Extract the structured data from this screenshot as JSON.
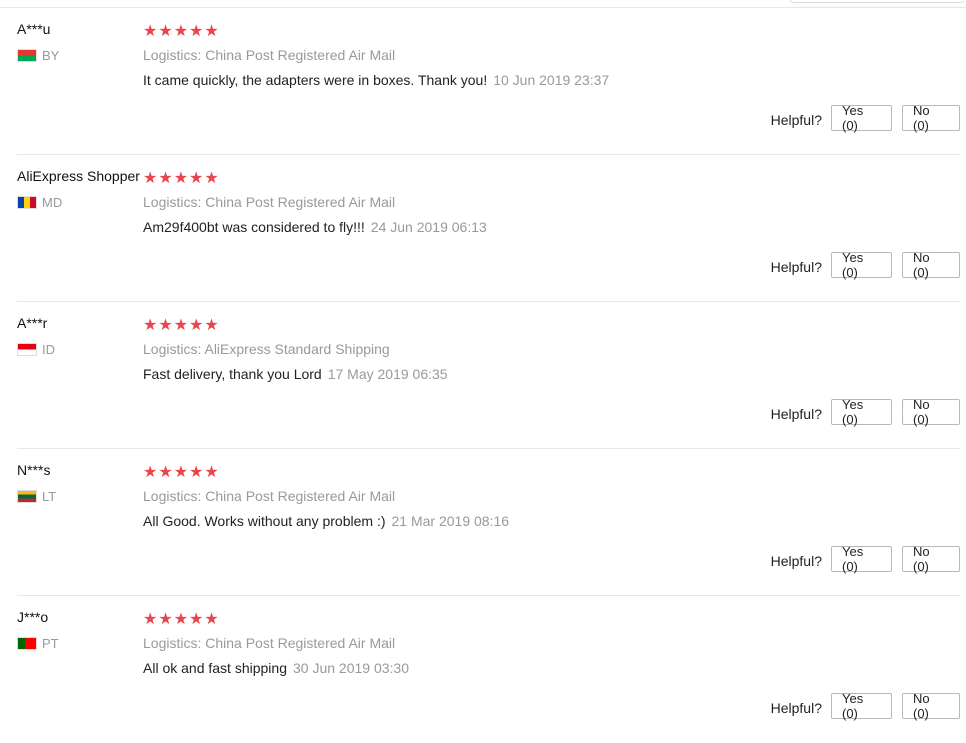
{
  "reviews": [
    {
      "user": "A***u",
      "country": "BY",
      "flag_colors": [
        "#e6372f",
        "#00a651"
      ],
      "stars": "★★★★★",
      "logistics_label": "Logistics:",
      "logistics": "China Post Registered Air Mail",
      "comment": "It came quickly, the adapters were in boxes. Thank you!",
      "date": "10 Jun 2019 23:37",
      "helpful_label": "Helpful?",
      "yes_label": "Yes (0)",
      "no_label": "No (0)"
    },
    {
      "user": "AliExpress Shopper",
      "country": "MD",
      "flag_colors": [
        "#0046ae",
        "#ffd200",
        "#cc092f"
      ],
      "stars": "★★★★★",
      "logistics_label": "Logistics:",
      "logistics": "China Post Registered Air Mail",
      "comment": "Am29f400bt was considered to fly!!!",
      "date": "24 Jun 2019 06:13",
      "helpful_label": "Helpful?",
      "yes_label": "Yes (0)",
      "no_label": "No (0)"
    },
    {
      "user": "A***r",
      "country": "ID",
      "flag_colors": [
        "#e70011",
        "#ffffff"
      ],
      "stars": "★★★★★",
      "logistics_label": "Logistics:",
      "logistics": "AliExpress Standard Shipping",
      "comment": "Fast delivery, thank you Lord",
      "date": "17 May 2019 06:35",
      "helpful_label": "Helpful?",
      "yes_label": "Yes (0)",
      "no_label": "No (0)"
    },
    {
      "user": "N***s",
      "country": "LT",
      "flag_colors": [
        "#fdb913",
        "#006a44",
        "#c1272d"
      ],
      "stars": "★★★★★",
      "logistics_label": "Logistics:",
      "logistics": "China Post Registered Air Mail",
      "comment": "All Good. Works without any problem :)",
      "date": "21 Mar 2019 08:16",
      "helpful_label": "Helpful?",
      "yes_label": "Yes (0)",
      "no_label": "No (0)"
    },
    {
      "user": "J***o",
      "country": "PT",
      "flag_colors": [
        "#006600",
        "#ff0000"
      ],
      "stars": "★★★★★",
      "logistics_label": "Logistics:",
      "logistics": "China Post Registered Air Mail",
      "comment": "All ok and fast shipping",
      "date": "30 Jun 2019 03:30",
      "helpful_label": "Helpful?",
      "yes_label": "Yes (0)",
      "no_label": "No (0)"
    }
  ]
}
